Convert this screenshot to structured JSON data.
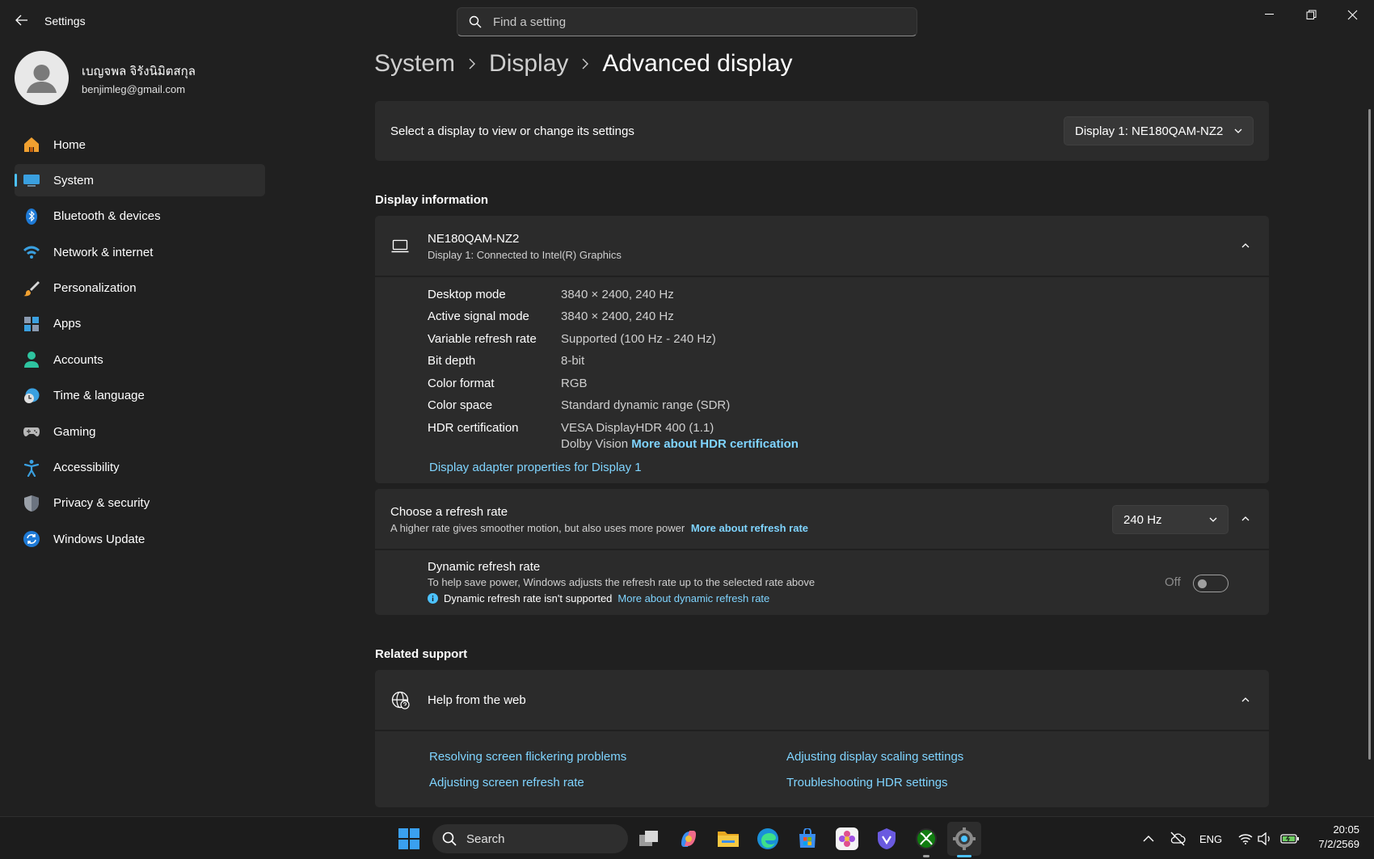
{
  "window": {
    "title": "Settings",
    "search_placeholder": "Find a setting"
  },
  "profile": {
    "name": "เบญจพล จิรังนิมิตสกุล",
    "email": "benjimleg@gmail.com"
  },
  "sidebar": {
    "items": [
      {
        "label": "Home",
        "icon": "home-icon",
        "active": false
      },
      {
        "label": "System",
        "icon": "system-icon",
        "active": true
      },
      {
        "label": "Bluetooth & devices",
        "icon": "bluetooth-icon",
        "active": false
      },
      {
        "label": "Network & internet",
        "icon": "wifi-icon",
        "active": false
      },
      {
        "label": "Personalization",
        "icon": "brush-icon",
        "active": false
      },
      {
        "label": "Apps",
        "icon": "apps-icon",
        "active": false
      },
      {
        "label": "Accounts",
        "icon": "accounts-icon",
        "active": false
      },
      {
        "label": "Time & language",
        "icon": "clock-globe-icon",
        "active": false
      },
      {
        "label": "Gaming",
        "icon": "gamepad-icon",
        "active": false
      },
      {
        "label": "Accessibility",
        "icon": "accessibility-icon",
        "active": false
      },
      {
        "label": "Privacy & security",
        "icon": "shield-icon",
        "active": false
      },
      {
        "label": "Windows Update",
        "icon": "update-icon",
        "active": false
      }
    ]
  },
  "breadcrumb": {
    "items": [
      "System",
      "Display"
    ],
    "current": "Advanced display"
  },
  "select_display": {
    "label": "Select a display to view or change its settings",
    "value": "Display 1: NE180QAM-NZ2"
  },
  "display_info": {
    "section_title": "Display information",
    "name": "NE180QAM-NZ2",
    "subtitle": "Display 1: Connected to Intel(R) Graphics",
    "rows": [
      {
        "key": "Desktop mode",
        "value": "3840 × 2400, 240 Hz"
      },
      {
        "key": "Active signal mode",
        "value": "3840 × 2400, 240 Hz"
      },
      {
        "key": "Variable refresh rate",
        "value": "Supported (100 Hz - 240 Hz)"
      },
      {
        "key": "Bit depth",
        "value": "8-bit"
      },
      {
        "key": "Color format",
        "value": "RGB"
      },
      {
        "key": "Color space",
        "value": "Standard dynamic range (SDR)"
      },
      {
        "key": "HDR certification",
        "value": "VESA DisplayHDR 400 (1.1)"
      }
    ],
    "hdr_extra": "Dolby Vision",
    "hdr_link": "More about HDR certification",
    "adapter_link": "Display adapter properties for Display 1"
  },
  "refresh_rate": {
    "title": "Choose a refresh rate",
    "subtitle": "A higher rate gives smoother motion, but also uses more power",
    "link": "More about refresh rate",
    "value": "240 Hz",
    "dynamic_title": "Dynamic refresh rate",
    "dynamic_desc": "To help save power, Windows adjusts the refresh rate up to the selected rate above",
    "dynamic_note": "Dynamic refresh rate isn't supported",
    "dynamic_link": "More about dynamic refresh rate",
    "toggle_state": "Off"
  },
  "related_support": {
    "section_title": "Related support",
    "help_title": "Help from the web",
    "links": [
      "Resolving screen flickering problems",
      "Adjusting display scaling settings",
      "Adjusting screen refresh rate",
      "Troubleshooting HDR settings"
    ]
  },
  "taskbar": {
    "search_label": "Search",
    "language": "ENG",
    "time": "20:05",
    "date": "7/2/2569"
  },
  "colors": {
    "accent": "#4cc2ff",
    "link": "#7fd4ff",
    "background": "#202020",
    "card": "#2b2b2b"
  }
}
